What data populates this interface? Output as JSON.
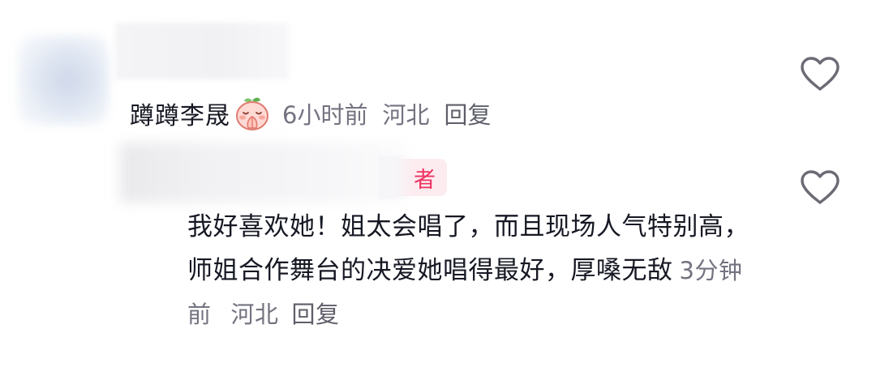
{
  "comment1": {
    "author": "蹲蹲李晟",
    "emoji": "praying-peach-emoji",
    "time": "6小时前",
    "location": "河北",
    "reply_label": "回复"
  },
  "comment2": {
    "badge": "者",
    "text": "我好喜欢她！姐太会唱了，而且现场人气特别高，师姐合作舞台的决爱她唱得最好，厚嗓无敌",
    "time": "3分钟前",
    "location": "河北",
    "reply_label": "回复"
  },
  "icons": {
    "like": "heart-outline-icon"
  },
  "colors": {
    "text_primary": "#161823",
    "text_meta": "#737380",
    "badge_text": "#ef3160",
    "badge_bg": "#fdecef"
  }
}
